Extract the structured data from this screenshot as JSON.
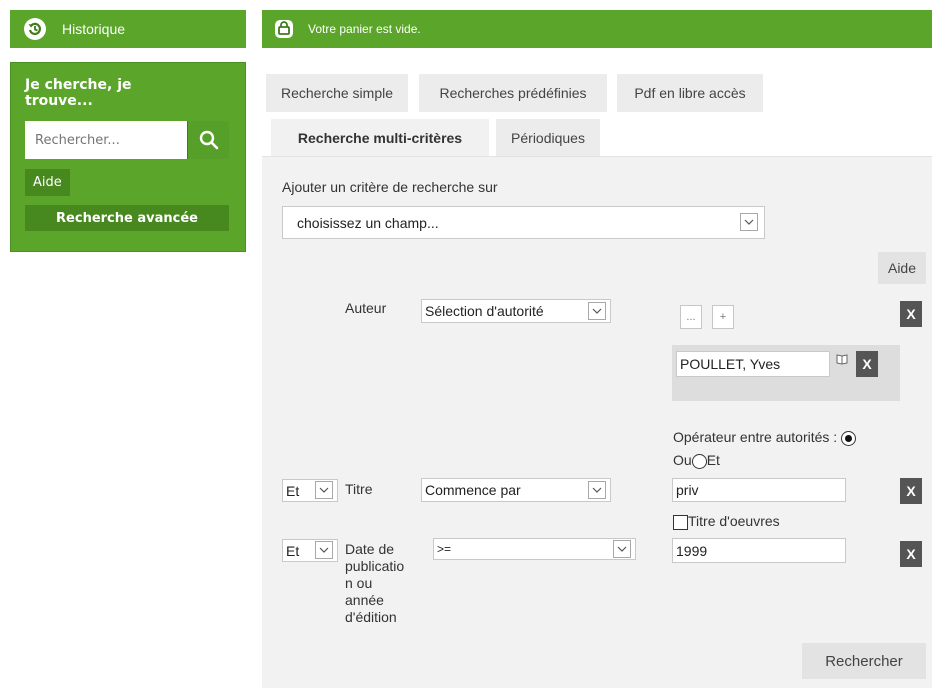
{
  "sidebar": {
    "history_label": "Historique",
    "search_title": "Je cherche, je trouve...",
    "search_placeholder": "Rechercher...",
    "help_label": "Aide",
    "advanced_label": "Recherche avancée"
  },
  "cart": {
    "status": "Votre panier est vide."
  },
  "tabs": {
    "row1": [
      "Recherche simple",
      "Recherches prédéfinies",
      "Pdf en libre accès"
    ],
    "row2": [
      "Recherche multi-critères",
      "Périodiques"
    ]
  },
  "form": {
    "add_criteria_label": "Ajouter un critère de recherche sur",
    "field_select_value": "choisissez un champ...",
    "help_label": "Aide",
    "author": {
      "label": "Auteur",
      "mode": "Sélection d'autorité",
      "browse_label": "...",
      "add_label": "+",
      "selected_authority": "POULLET, Yves",
      "operator_label": "Opérateur entre autorités :",
      "or_label": "Ou",
      "and_label": "Et"
    },
    "title": {
      "operator": "Et",
      "label": "Titre",
      "mode": "Commence par",
      "value": "priv",
      "works_checkbox_label": "Titre d'oeuvres"
    },
    "date": {
      "operator": "Et",
      "label_lines": [
        "Date de",
        "publicatio",
        "n ou",
        "année",
        "d'édition"
      ],
      "mode": ">=",
      "value": "1999"
    },
    "remove_label": "X",
    "submit_label": "Rechercher"
  }
}
